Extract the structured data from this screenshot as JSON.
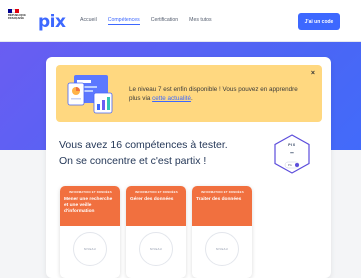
{
  "gov_logo": {
    "text": "RÉPUBLIQUE FRANÇAISE"
  },
  "brand": {
    "name": "pix",
    "color": "#3d68ff"
  },
  "nav": {
    "items": [
      {
        "label": "Accueil",
        "active": false
      },
      {
        "label": "Compétences",
        "active": true
      },
      {
        "label": "Certification",
        "active": false
      },
      {
        "label": "Mes tutos",
        "active": false
      }
    ],
    "code_button": "J'ai un code"
  },
  "banner": {
    "text": "Le niveau 7 est enfin disponible ! Vous pouvez en apprendre plus via ",
    "link": "cette actualité",
    "suffix": ".",
    "close": "×",
    "color": "#ffd880"
  },
  "headline": {
    "line1": "Vous avez 16 compétences à tester.",
    "line2": "On se concentre et c'est partix !"
  },
  "score_badge": {
    "brand": "PIX",
    "value": "–",
    "unit": "Pix"
  },
  "cards": [
    {
      "domain": "INFORMATION ET DONNÉES",
      "title": "Mener une recherche et une veille d'information",
      "level_label": "NIVEAU"
    },
    {
      "domain": "INFORMATION ET DONNÉES",
      "title": "Gérer des données",
      "level_label": "NIVEAU"
    },
    {
      "domain": "INFORMATION ET DONNÉES",
      "title": "Traiter des données",
      "level_label": "NIVEAU"
    }
  ],
  "colors": {
    "accent": "#3d68ff",
    "card_head": "#f1703f",
    "hero_start": "#6a5df2",
    "hero_end": "#3b6fff"
  }
}
